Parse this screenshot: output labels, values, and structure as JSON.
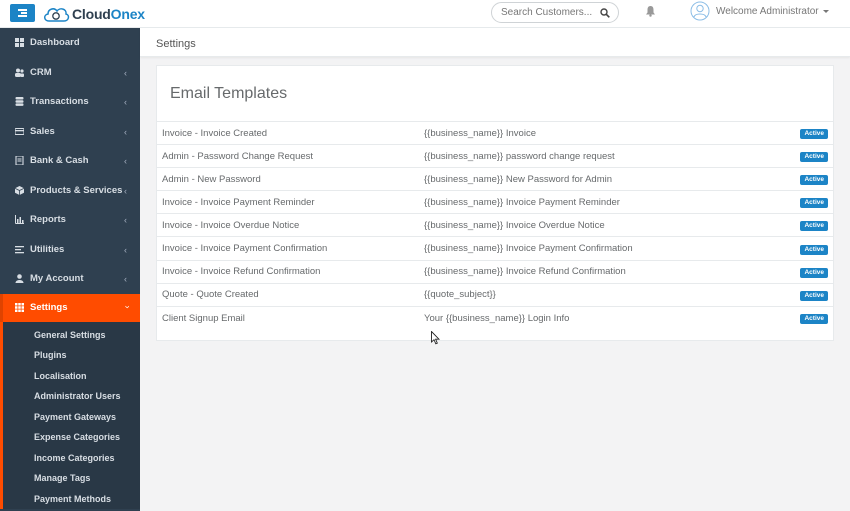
{
  "brand": {
    "name_part1": "Cloud",
    "name_part2": "Onex",
    "accent": "#1c84c6",
    "sidebar_bg": "#2f4050",
    "active_color": "#ff4c00"
  },
  "header": {
    "search_placeholder": "Search Customers...",
    "user_label": "Welcome Administrator"
  },
  "sidebar": {
    "items": [
      {
        "label": "Dashboard",
        "icon": "dashboard-icon",
        "has_submenu": false
      },
      {
        "label": "CRM",
        "icon": "users-icon",
        "has_submenu": true
      },
      {
        "label": "Transactions",
        "icon": "database-icon",
        "has_submenu": true
      },
      {
        "label": "Sales",
        "icon": "credit-card-icon",
        "has_submenu": true
      },
      {
        "label": "Bank & Cash",
        "icon": "book-icon",
        "has_submenu": true
      },
      {
        "label": "Products & Services",
        "icon": "cube-icon",
        "has_submenu": true
      },
      {
        "label": "Reports",
        "icon": "bar-chart-icon",
        "has_submenu": true
      },
      {
        "label": "Utilities",
        "icon": "list-icon",
        "has_submenu": true
      },
      {
        "label": "My Account",
        "icon": "user-icon",
        "has_submenu": true
      },
      {
        "label": "Settings",
        "icon": "settings-icon",
        "has_submenu": true,
        "active": true
      }
    ],
    "settings_submenu": [
      "General Settings",
      "Plugins",
      "Localisation",
      "Administrator Users",
      "Payment Gateways",
      "Expense Categories",
      "Income Categories",
      "Manage Tags",
      "Payment Methods"
    ]
  },
  "page": {
    "title": "Settings",
    "panel_title": "Email Templates"
  },
  "templates": [
    {
      "name": "Invoice - Invoice Created",
      "subject": "{{business_name}} Invoice",
      "status": "Active"
    },
    {
      "name": "Admin - Password Change Request",
      "subject": "{{business_name}} password change request",
      "status": "Active"
    },
    {
      "name": "Admin - New Password",
      "subject": "{{business_name}} New Password for Admin",
      "status": "Active"
    },
    {
      "name": "Invoice - Invoice Payment Reminder",
      "subject": "{{business_name}} Invoice Payment Reminder",
      "status": "Active"
    },
    {
      "name": "Invoice - Invoice Overdue Notice",
      "subject": "{{business_name}} Invoice Overdue Notice",
      "status": "Active"
    },
    {
      "name": "Invoice - Invoice Payment Confirmation",
      "subject": "{{business_name}} Invoice Payment Confirmation",
      "status": "Active"
    },
    {
      "name": "Invoice - Invoice Refund Confirmation",
      "subject": "{{business_name}} Invoice Refund Confirmation",
      "status": "Active"
    },
    {
      "name": "Quote - Quote Created",
      "subject": "{{quote_subject}}",
      "status": "Active"
    },
    {
      "name": "Client Signup Email",
      "subject": "Your {{business_name}} Login Info",
      "status": "Active"
    }
  ]
}
